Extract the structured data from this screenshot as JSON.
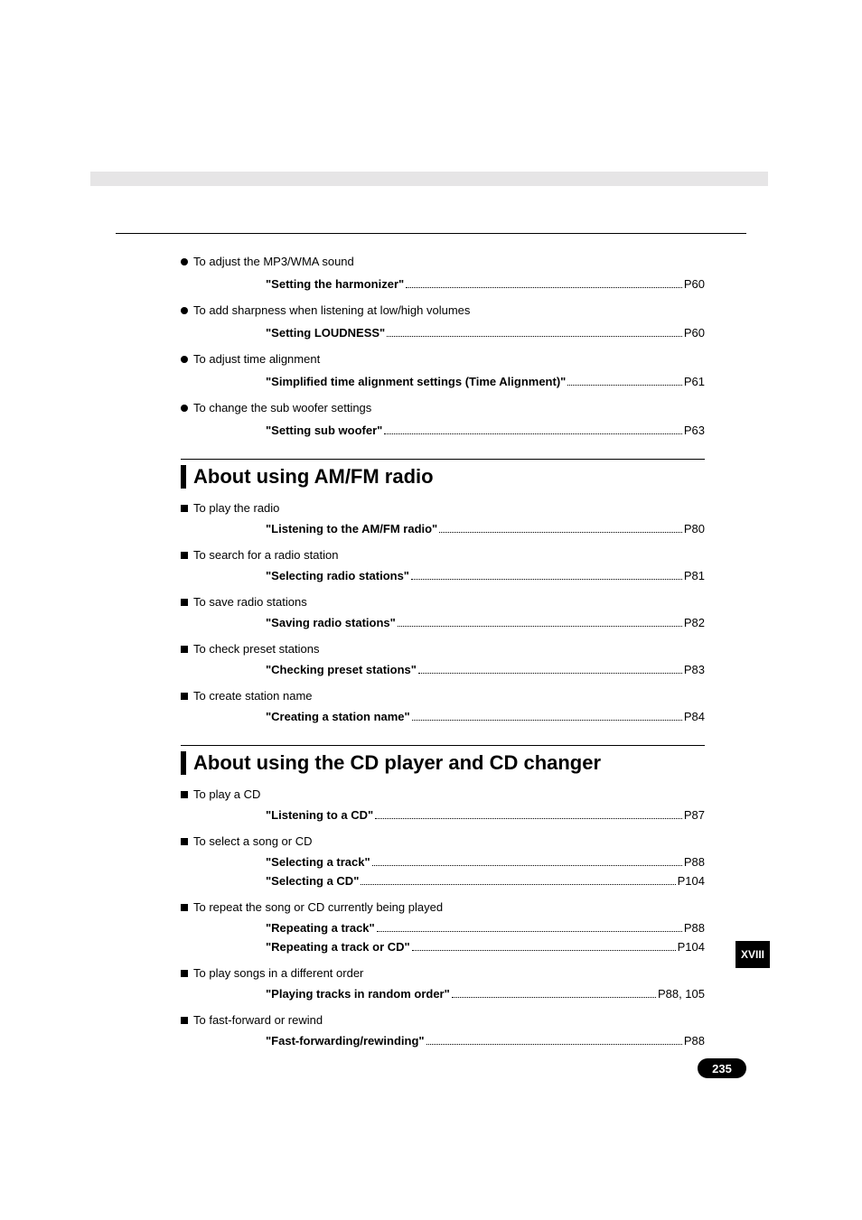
{
  "top": {
    "items": [
      {
        "label": "To adjust the MP3/WMA sound",
        "refs": [
          {
            "title": "\"Setting the harmonizer\"",
            "page": "P60"
          }
        ]
      },
      {
        "label": "To add sharpness when listening at low/high volumes",
        "refs": [
          {
            "title": "\"Setting LOUDNESS\"",
            "page": "P60"
          }
        ]
      },
      {
        "label": "To adjust time alignment",
        "refs": [
          {
            "title": "\"Simplified time alignment settings (Time Alignment)\"",
            "page": "P61"
          }
        ]
      },
      {
        "label": "To change the sub woofer settings",
        "refs": [
          {
            "title": "\"Setting sub woofer\"",
            "page": "P63"
          }
        ]
      }
    ]
  },
  "section1": {
    "title": "About using AM/FM radio",
    "items": [
      {
        "label": "To play the radio",
        "refs": [
          {
            "title": "\"Listening to the AM/FM radio\"",
            "page": "P80"
          }
        ]
      },
      {
        "label": "To search for a radio station",
        "refs": [
          {
            "title": "\"Selecting radio stations\"",
            "page": "P81"
          }
        ]
      },
      {
        "label": "To save radio stations",
        "refs": [
          {
            "title": "\"Saving radio stations\"",
            "page": "P82"
          }
        ]
      },
      {
        "label": "To check preset stations",
        "refs": [
          {
            "title": "\"Checking preset stations\"",
            "page": "P83"
          }
        ]
      },
      {
        "label": "To create station name",
        "refs": [
          {
            "title": "\"Creating a station name\"",
            "page": "P84"
          }
        ]
      }
    ]
  },
  "section2": {
    "title": "About using the CD player and CD changer",
    "items": [
      {
        "label": "To play a CD",
        "refs": [
          {
            "title": "\"Listening to a CD\"",
            "page": "P87"
          }
        ]
      },
      {
        "label": "To select a song or CD",
        "refs": [
          {
            "title": "\"Selecting a track\"",
            "page": "P88"
          },
          {
            "title": "\"Selecting a CD\"",
            "page": "P104"
          }
        ]
      },
      {
        "label": "To repeat the song or CD currently being played",
        "refs": [
          {
            "title": "\"Repeating a track\"",
            "page": "P88"
          },
          {
            "title": "\"Repeating a track or CD\"",
            "page": "P104"
          }
        ]
      },
      {
        "label": "To play songs in a different order",
        "refs": [
          {
            "title": "\"Playing tracks in random order\"",
            "page": "P88, 105"
          }
        ]
      },
      {
        "label": "To fast-forward or rewind",
        "refs": [
          {
            "title": "\"Fast-forwarding/rewinding\"",
            "page": "P88"
          }
        ]
      }
    ]
  },
  "sidetab": "XVIII",
  "pageNumber": "235"
}
